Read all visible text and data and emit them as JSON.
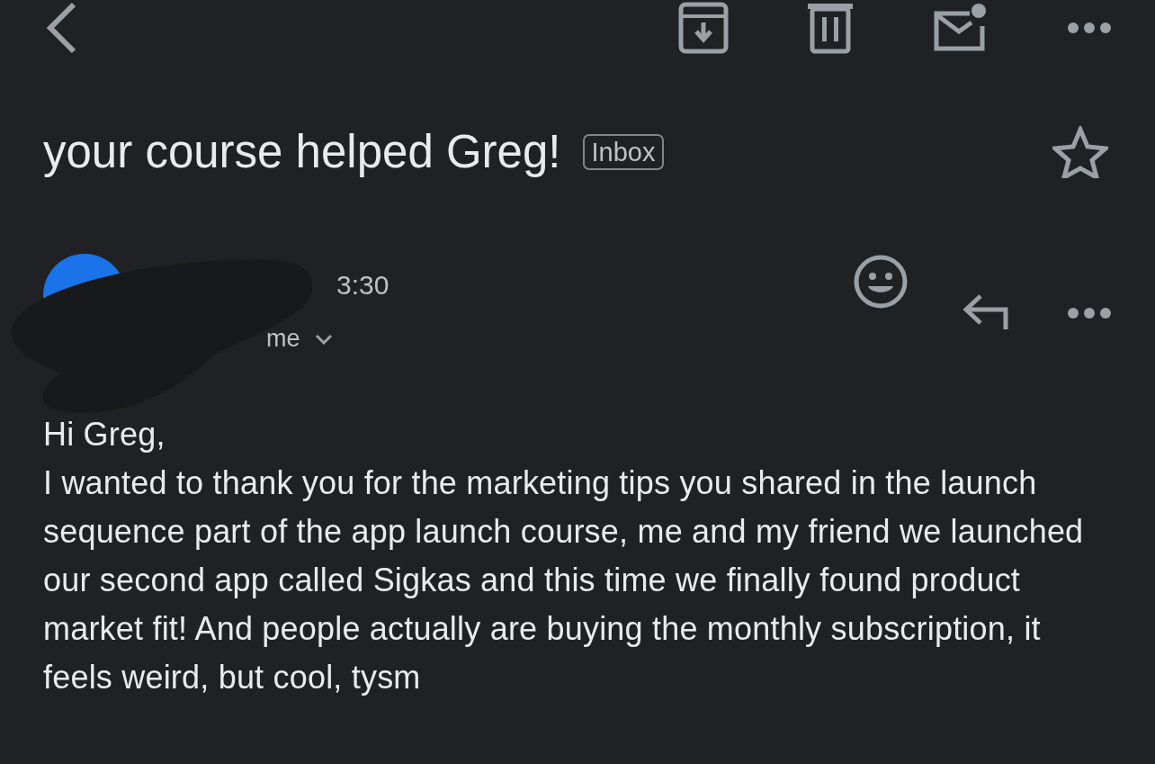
{
  "subject": "your course helped Greg!",
  "label": "Inbox",
  "starred": false,
  "message": {
    "time": "3:30",
    "recipient": "me"
  },
  "body": {
    "greeting": "Hi Greg,",
    "paragraph": "I wanted to thank you for the marketing tips you shared in the launch sequence part of the app launch course, me and my friend we launched our second app called Sigkas and this time we finally found product market fit! And people actually are buying the monthly subscription, it feels weird, but cool, tysm"
  }
}
